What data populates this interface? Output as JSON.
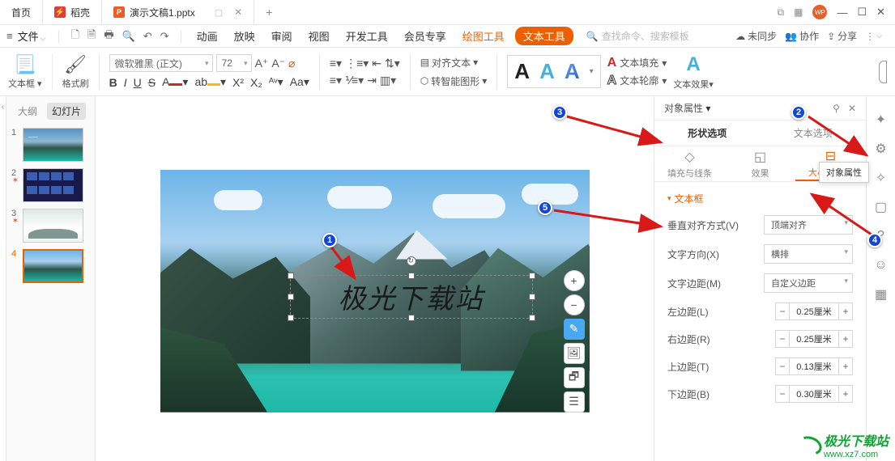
{
  "titlebar": {
    "home": "首页",
    "brand": "稻壳",
    "file": "演示文稿1.pptx",
    "wp": "WP"
  },
  "menubar": {
    "file": "文件",
    "items": [
      "动画",
      "放映",
      "审阅",
      "视图",
      "开发工具",
      "会员专享"
    ],
    "drawing": "绘图工具",
    "text": "文本工具",
    "search": "查找命令、搜索模板",
    "unsync": "未同步",
    "collab": "协作",
    "share": "分享"
  },
  "toolbar": {
    "textbox": "文本框",
    "formatbrush": "格式刷",
    "font": "微软雅黑 (正文)",
    "size": "72",
    "align_text": "对齐文本",
    "smart_shape": "转智能图形",
    "text_fill": "文本填充",
    "text_outline": "文本轮廓",
    "text_effect": "文本效果"
  },
  "sidebar": {
    "outline": "大纲",
    "slides": "幻灯片",
    "nums": [
      "1",
      "2",
      "3",
      "4"
    ]
  },
  "slide": {
    "text": "极光下载站"
  },
  "prop": {
    "header": "对象属性",
    "tabs": {
      "shape": "形状选项",
      "text": "文本选项"
    },
    "subtabs": {
      "fill": "填充与线条",
      "effect": "效果",
      "size": "大小与属性"
    },
    "tooltip": "对象属性",
    "section": "文本框",
    "rows": {
      "valign": {
        "label": "垂直对齐方式(V)",
        "value": "顶端对齐"
      },
      "textdir": {
        "label": "文字方向(X)",
        "value": "横排"
      },
      "margin": {
        "label": "文字边距(M)",
        "value": "自定义边距"
      },
      "left": {
        "label": "左边距(L)",
        "value": "0.25厘米"
      },
      "right": {
        "label": "右边距(R)",
        "value": "0.25厘米"
      },
      "top": {
        "label": "上边距(T)",
        "value": "0.13厘米"
      },
      "bottom": {
        "label": "下边距(B)",
        "value": "0.30厘米"
      }
    }
  },
  "annotations": [
    "1",
    "2",
    "3",
    "4",
    "5"
  ],
  "watermark": {
    "brand": "极光下载站",
    "url": "www.xz7.com"
  }
}
